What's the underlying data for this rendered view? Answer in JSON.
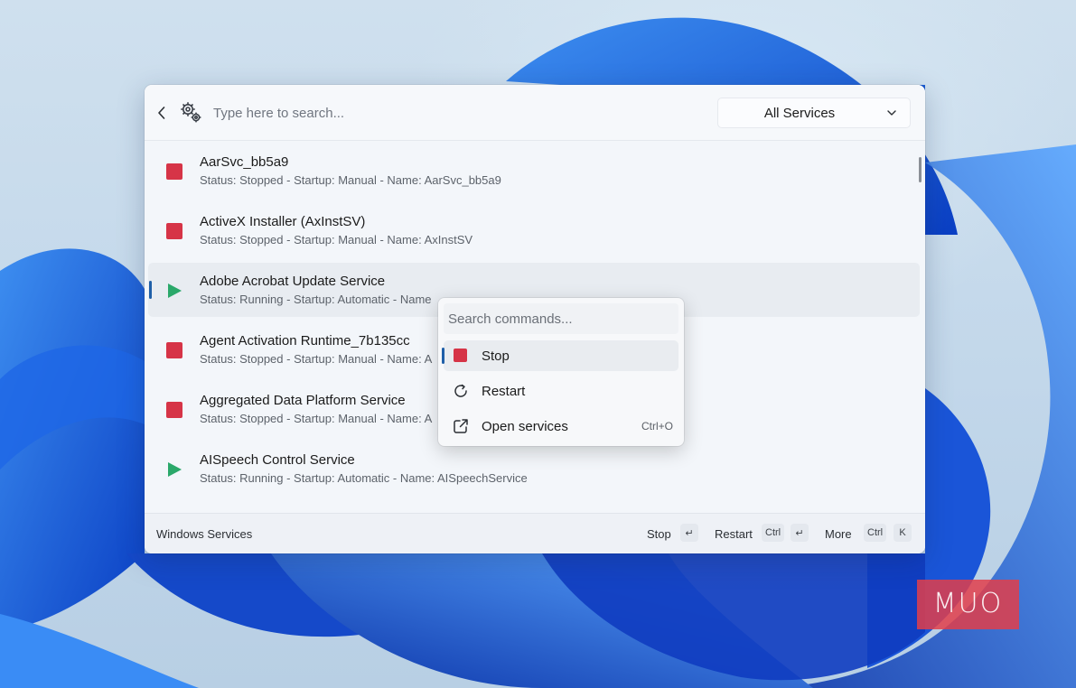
{
  "search": {
    "placeholder": "Type here to search..."
  },
  "filter": {
    "selected": "All Services"
  },
  "services": [
    {
      "title": "AarSvc_bb5a9",
      "status": "stopped",
      "subtitle": "Status: Stopped - Startup: Manual - Name: AarSvc_bb5a9"
    },
    {
      "title": "ActiveX Installer (AxInstSV)",
      "status": "stopped",
      "subtitle": "Status: Stopped - Startup: Manual - Name: AxInstSV"
    },
    {
      "title": "Adobe Acrobat Update Service",
      "status": "running",
      "subtitle": "Status: Running - Startup: Automatic - Name"
    },
    {
      "title": "Agent Activation Runtime_7b135cc",
      "status": "stopped",
      "subtitle": "Status: Stopped - Startup: Manual - Name: A"
    },
    {
      "title": "Aggregated Data Platform Service",
      "status": "stopped",
      "subtitle": "Status: Stopped - Startup: Manual - Name: A"
    },
    {
      "title": "AISpeech Control Service",
      "status": "running",
      "subtitle": "Status: Running - Startup: Automatic - Name: AISpeechService"
    }
  ],
  "footer": {
    "title": "Windows Services",
    "stop_label": "Stop",
    "stop_key": "↵",
    "restart_label": "Restart",
    "restart_key_mod": "Ctrl",
    "restart_key": "↵",
    "more_label": "More",
    "more_key_mod": "Ctrl",
    "more_key": "K"
  },
  "menu": {
    "placeholder": "Search commands...",
    "items": [
      {
        "label": "Stop",
        "shortcut": ""
      },
      {
        "label": "Restart",
        "shortcut": ""
      },
      {
        "label": "Open services",
        "shortcut": "Ctrl+O"
      }
    ]
  },
  "logo": {
    "text": "MUO"
  },
  "colors": {
    "stop": "#d63447",
    "run": "#2aa86a",
    "accent": "#1f5fa8"
  }
}
